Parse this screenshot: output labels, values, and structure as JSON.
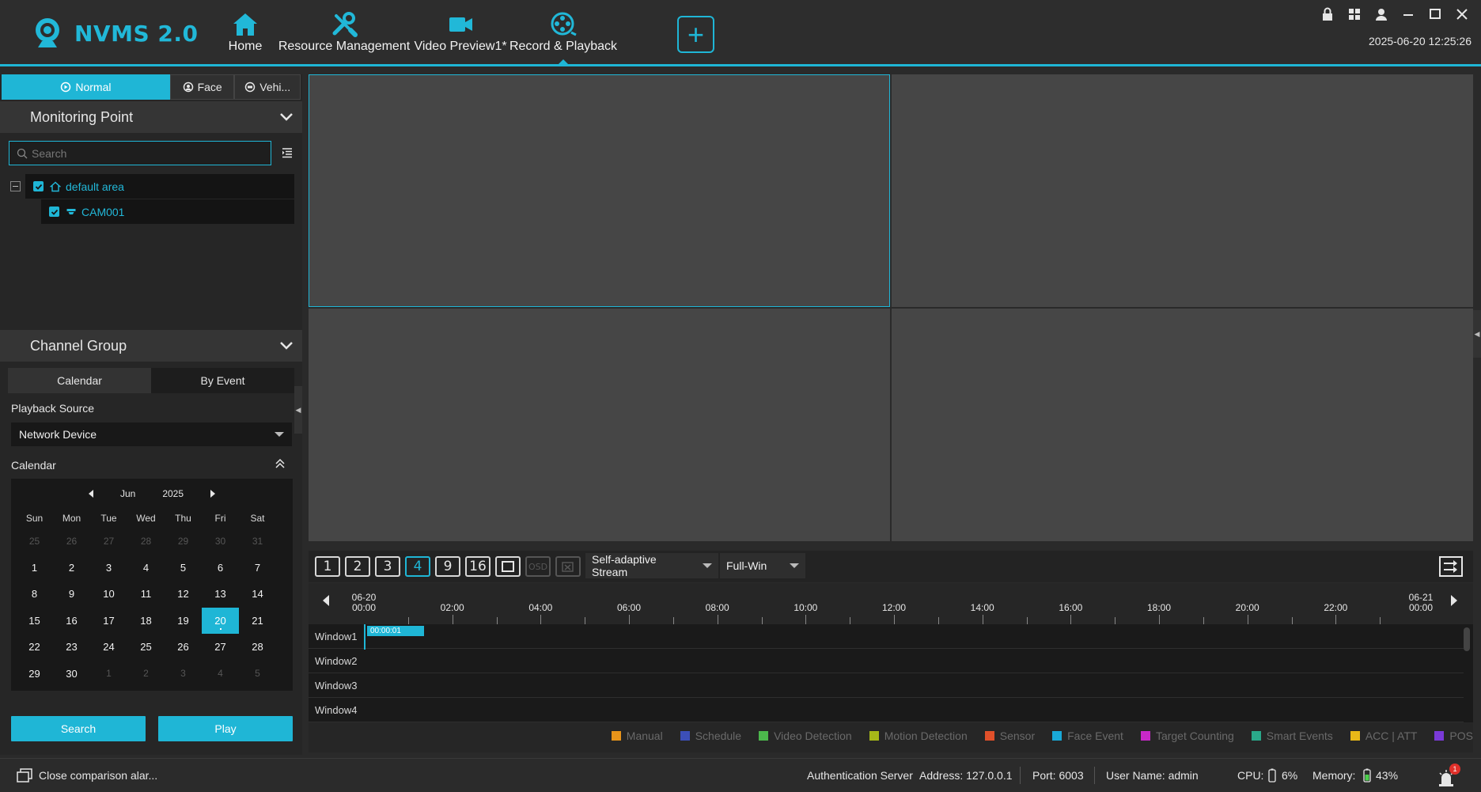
{
  "app": {
    "name": "NVMS 2.0",
    "datetime": "2025-06-20 12:25:26"
  },
  "nav": {
    "items": [
      {
        "label": "Home",
        "icon": "home-icon"
      },
      {
        "label": "Resource Management",
        "icon": "tools-icon"
      },
      {
        "label": "Video Preview1*",
        "icon": "camera-icon"
      },
      {
        "label": "Record & Playback",
        "icon": "film-reel-icon",
        "active": true
      }
    ],
    "add_label": "+"
  },
  "window_controls": [
    "lock-icon",
    "grid-icon",
    "user-icon",
    "minimize-icon",
    "maximize-icon",
    "close-icon"
  ],
  "mode_tabs": [
    {
      "label": "Normal",
      "active": true
    },
    {
      "label": "Face"
    },
    {
      "label": "Vehi..."
    }
  ],
  "monitoring": {
    "title": "Monitoring Point",
    "search_placeholder": "Search",
    "tree": {
      "area": "default area",
      "camera": "CAM001"
    }
  },
  "channel_group": {
    "title": "Channel Group"
  },
  "playback": {
    "tabs": [
      {
        "label": "Calendar",
        "active": true
      },
      {
        "label": "By Event"
      }
    ],
    "source_label": "Playback Source",
    "source_value": "Network Device",
    "calendar_label": "Calendar",
    "month": "Jun",
    "year": "2025",
    "dow": [
      "Sun",
      "Mon",
      "Tue",
      "Wed",
      "Thu",
      "Fri",
      "Sat"
    ],
    "weeks": [
      [
        "25",
        "26",
        "27",
        "28",
        "29",
        "30",
        "31"
      ],
      [
        "1",
        "2",
        "3",
        "4",
        "5",
        "6",
        "7"
      ],
      [
        "8",
        "9",
        "10",
        "11",
        "12",
        "13",
        "14"
      ],
      [
        "15",
        "16",
        "17",
        "18",
        "19",
        "20",
        "21"
      ],
      [
        "22",
        "23",
        "24",
        "25",
        "26",
        "27",
        "28"
      ],
      [
        "29",
        "30",
        "1",
        "2",
        "3",
        "4",
        "5"
      ]
    ],
    "selected_day": "20",
    "search_button": "Search",
    "play_button": "Play"
  },
  "toolbar": {
    "layouts": [
      "1",
      "2",
      "3",
      "4",
      "9",
      "16"
    ],
    "active_layout": "4",
    "osd_label": "OSD",
    "stream": "Self-adaptive Stream",
    "window_mode": "Full-Win"
  },
  "timeline": {
    "start": {
      "date": "06-20",
      "time": "00:00"
    },
    "end": {
      "date": "06-21",
      "time": "00:00"
    },
    "hours": [
      "02:00",
      "04:00",
      "06:00",
      "08:00",
      "10:00",
      "12:00",
      "14:00",
      "16:00",
      "18:00",
      "20:00",
      "22:00"
    ],
    "windows": [
      "Window1",
      "Window2",
      "Window3",
      "Window4"
    ],
    "current_time": "00:00:01"
  },
  "legend": [
    {
      "label": "Manual",
      "color": "#e8941a"
    },
    {
      "label": "Schedule",
      "color": "#3c4fb8"
    },
    {
      "label": "Video Detection",
      "color": "#4cb84c"
    },
    {
      "label": "Motion Detection",
      "color": "#a6b818"
    },
    {
      "label": "Sensor",
      "color": "#e0502a"
    },
    {
      "label": "Face Event",
      "color": "#19a9d8"
    },
    {
      "label": "Target Counting",
      "color": "#c828c8"
    },
    {
      "label": "Smart Events",
      "color": "#2aa88a"
    },
    {
      "label": "ACC | ATT",
      "color": "#e8b818"
    },
    {
      "label": "POS",
      "color": "#7a3ad8"
    }
  ],
  "status": {
    "alarm_text": "Close comparison alar...",
    "auth_server": "Authentication Server",
    "address": "Address: 127.0.0.1",
    "port": "Port: 6003",
    "user": "User Name: admin",
    "cpu_label": "CPU:",
    "cpu_value": "6%",
    "memory_label": "Memory:",
    "memory_value": "43%",
    "alarm_count": "1"
  },
  "colors": {
    "accent": "#1fb6d6",
    "background": "#2a2a2a",
    "video_tile": "#464646"
  }
}
